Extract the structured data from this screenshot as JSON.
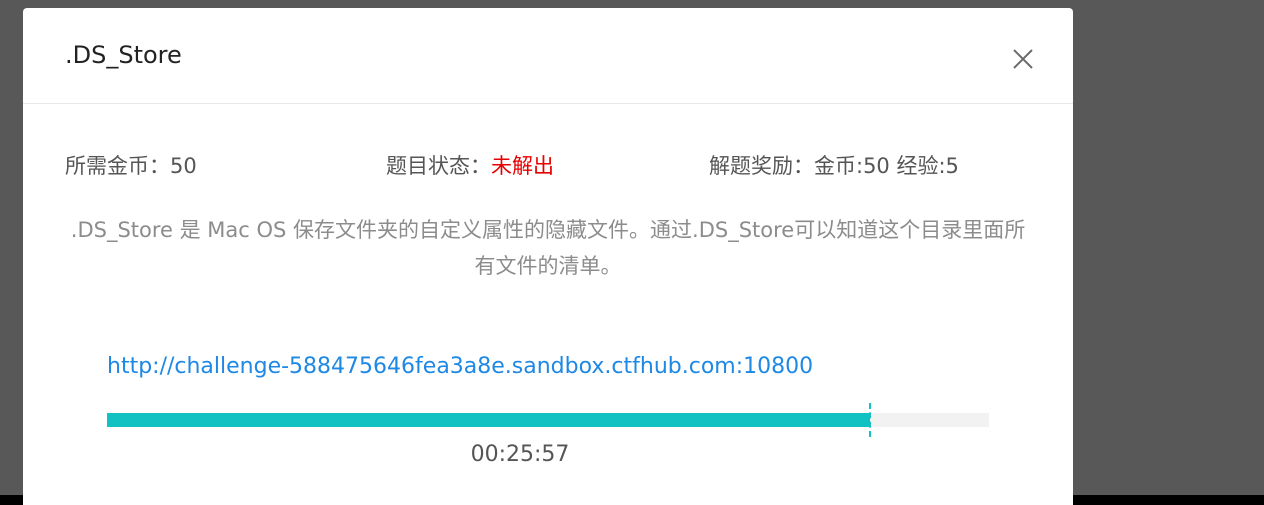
{
  "modal": {
    "title": ".DS_Store",
    "close_icon": "close-icon"
  },
  "info": {
    "cost_label": "所需金币：",
    "cost_value": "50",
    "status_label": "题目状态：",
    "status_value": "未解出",
    "reward_label": "解题奖励：",
    "reward_value": "金币:50 经验:5"
  },
  "description": ".DS_Store 是 Mac OS 保存文件夹的自定义属性的隐藏文件。通过.DS_Store可以知道这个目录里面所有文件的清单。",
  "challenge": {
    "url": "http://challenge-588475646fea3a8e.sandbox.ctfhub.com:10800"
  },
  "timer": {
    "remaining": "00:25:57",
    "progress_fraction": 0.865
  },
  "colors": {
    "status_unsolved": "#e60000",
    "link": "#1e88e5",
    "progress": "#12c2c2"
  }
}
